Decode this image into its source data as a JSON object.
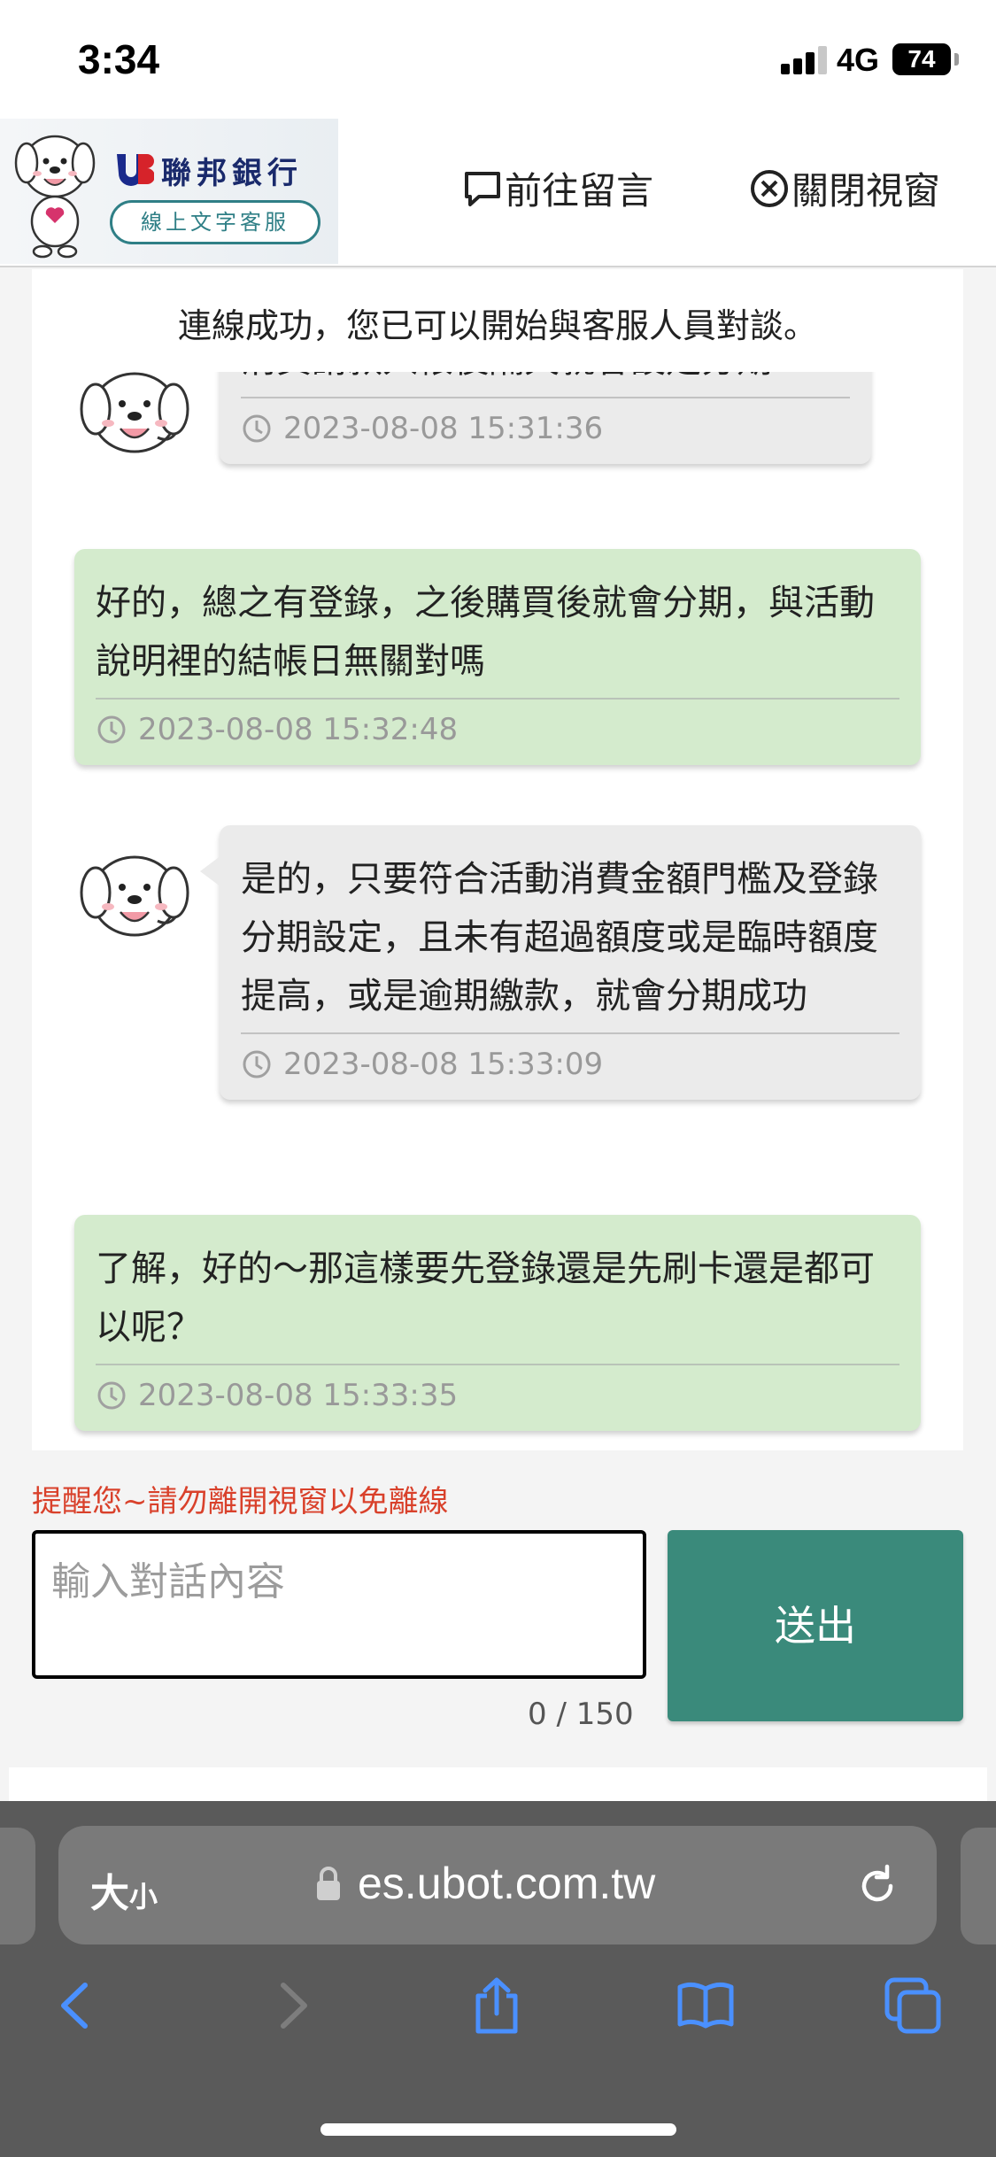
{
  "status": {
    "time": "3:34",
    "network": "4G",
    "battery": "74"
  },
  "header": {
    "brand_name": "聯邦銀行",
    "service_label": "線上文字客服",
    "leave_message_label": "前往留言",
    "close_window_label": "關閉視窗"
  },
  "notice": "連線成功，您已可以開始與客服人員對談。",
  "messages": [
    {
      "role": "agent",
      "text": "消費請款入帳後隔天就會設定分期",
      "time": "2023-08-08 15:31:36"
    },
    {
      "role": "user",
      "text": "好的，總之有登錄，之後購買後就會分期，與活動說明裡的結帳日無關對嗎",
      "time": "2023-08-08 15:32:48"
    },
    {
      "role": "agent",
      "text": "是的，只要符合活動消費金額門檻及登錄分期設定，且未有超過額度或是臨時額度提高，或是逾期繳款，就會分期成功",
      "time": "2023-08-08 15:33:09"
    },
    {
      "role": "user",
      "text": "了解，好的～那這樣要先登錄還是先刷卡還是都可以呢？",
      "time": "2023-08-08 15:33:35"
    }
  ],
  "reminder": "提醒您~請勿離開視窗以免離線",
  "input": {
    "placeholder": "輸入對話內容",
    "counter": "0 / 150"
  },
  "send_label": "送出",
  "browser": {
    "text_size": "大",
    "text_size_small": "小",
    "url": "es.ubot.com.tw"
  },
  "colors": {
    "accent": "#3a8a7b",
    "user_bubble": "#d4ebcd",
    "agent_bubble": "#ebebeb",
    "reminder": "#d9412b"
  }
}
